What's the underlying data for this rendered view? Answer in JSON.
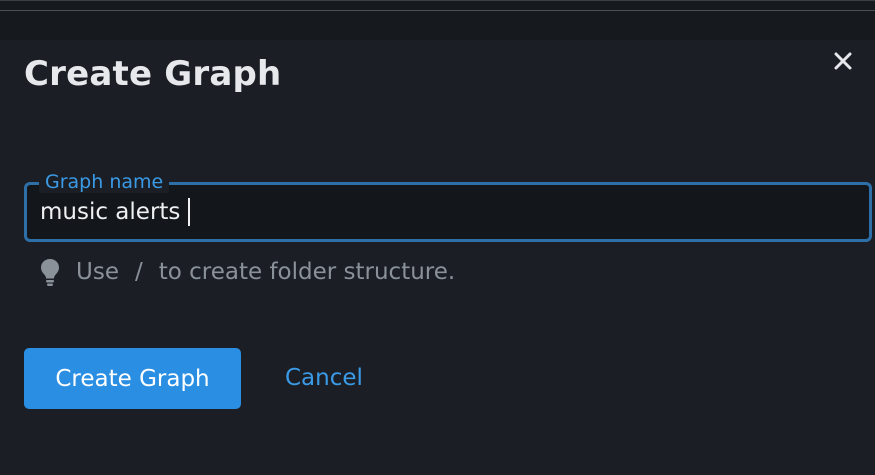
{
  "dialog": {
    "title": "Create Graph",
    "close_icon": "close-icon"
  },
  "form": {
    "name_label": "Graph name",
    "name_value": "music alerts",
    "hint_prefix": "Use",
    "hint_slash": "/",
    "hint_suffix": "to create folder structure.",
    "hint_icon": "lightbulb-icon"
  },
  "actions": {
    "submit_label": "Create Graph",
    "cancel_label": "Cancel"
  },
  "colors": {
    "accent": "#2a8ee2",
    "link": "#3a9ae6",
    "background": "#1b1f25"
  }
}
